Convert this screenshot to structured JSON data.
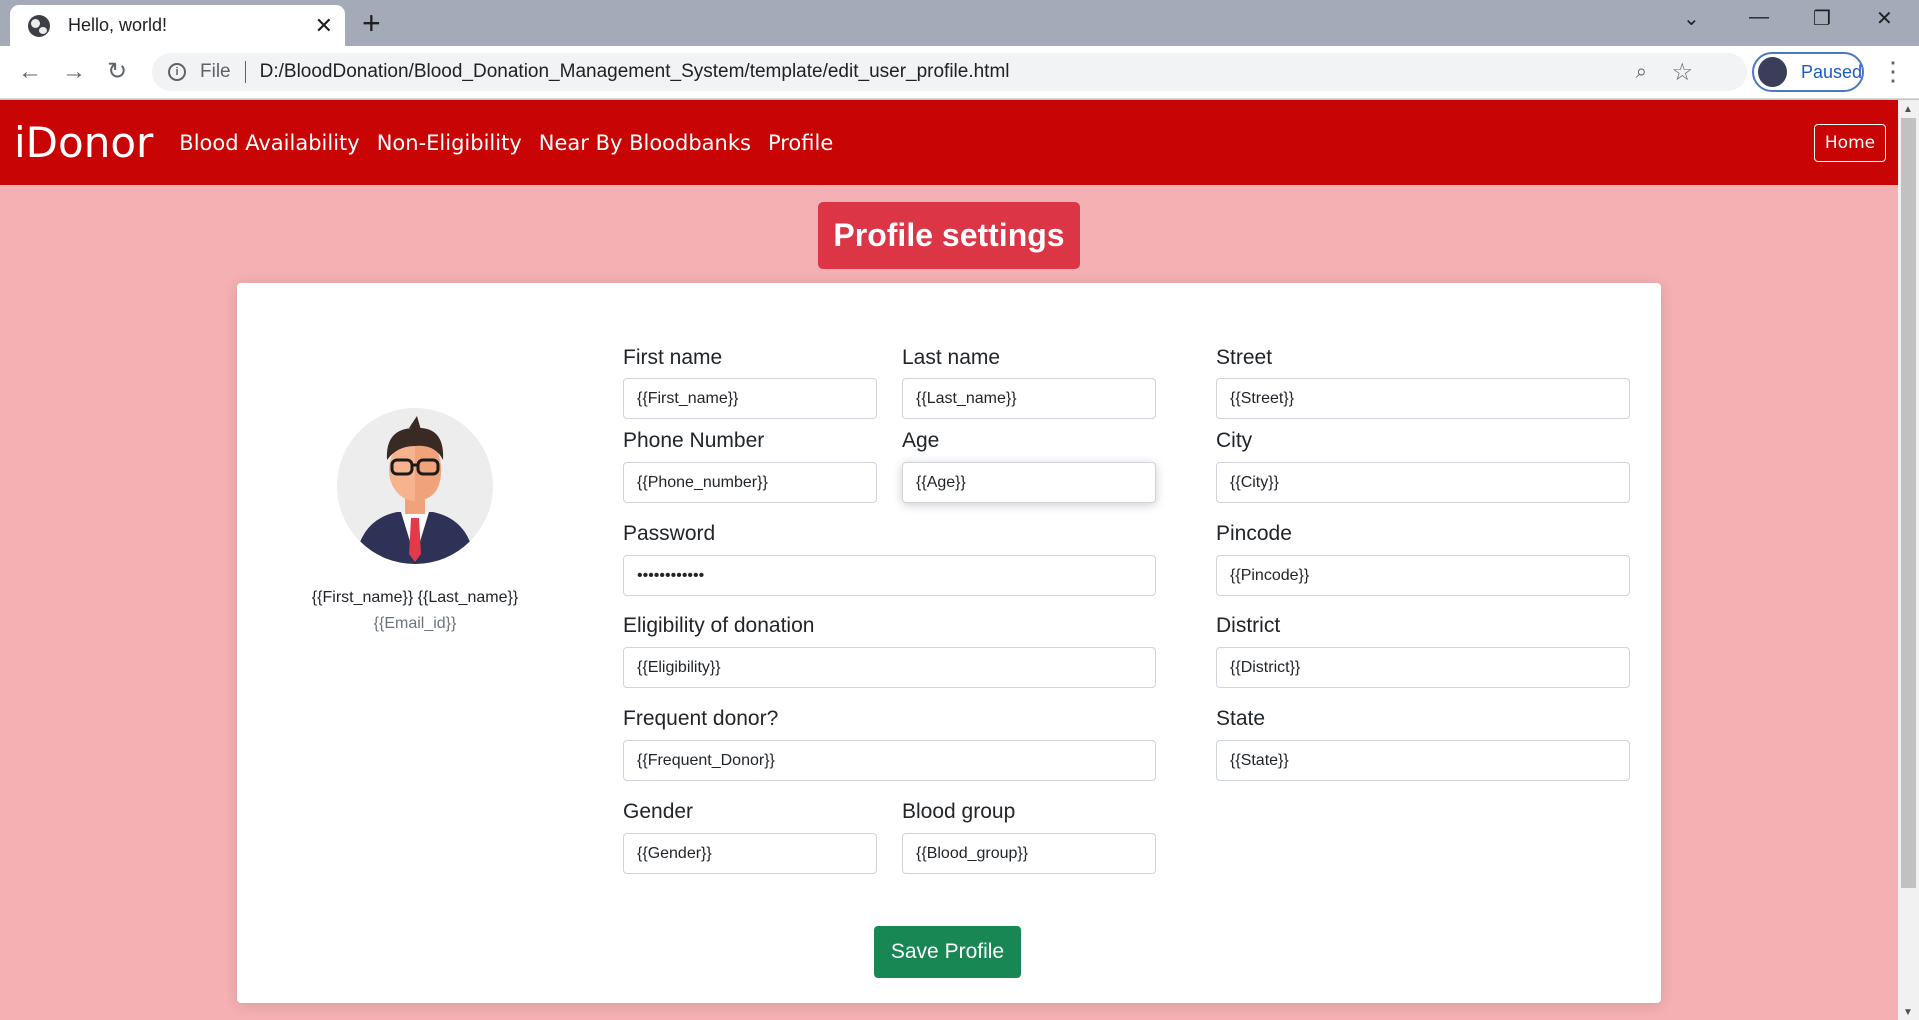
{
  "browser": {
    "tab_title": "Hello, world!",
    "address_scheme": "File",
    "url": "D:/BloodDonation/Blood_Donation_Management_System/template/edit_user_profile.html",
    "profile_status": "Paused"
  },
  "navbar": {
    "brand": "iDonor",
    "links": [
      "Blood Availability",
      "Non-Eligibility",
      "Near By Bloodbanks",
      "Profile"
    ],
    "home_label": "Home"
  },
  "page": {
    "heading": "Profile settings",
    "user_name": "{{First_name}} {{Last_name}}",
    "user_email": "{{Email_id}}",
    "save_label": "Save Profile"
  },
  "form": {
    "first_name": {
      "label": "First name",
      "value": "{{First_name}}"
    },
    "last_name": {
      "label": "Last name",
      "value": "{{Last_name}}"
    },
    "phone": {
      "label": "Phone Number",
      "value": "{{Phone_number}}"
    },
    "age": {
      "label": "Age",
      "value": "{{Age}}"
    },
    "password": {
      "label": "Password",
      "value": "••••••••••••"
    },
    "eligibility": {
      "label": "Eligibility of donation",
      "value": "{{Eligibility}}"
    },
    "frequent": {
      "label": "Frequent donor?",
      "value": "{{Frequent_Donor}}"
    },
    "gender": {
      "label": "Gender",
      "value": "{{Gender}}"
    },
    "blood_group": {
      "label": "Blood group",
      "value": "{{Blood_group}}"
    },
    "street": {
      "label": "Street",
      "value": "{{Street}}"
    },
    "city": {
      "label": "City",
      "value": "{{City}}"
    },
    "pincode": {
      "label": "Pincode",
      "value": "{{Pincode}}"
    },
    "district": {
      "label": "District",
      "value": "{{District}}"
    },
    "state": {
      "label": "State",
      "value": "{{State}}"
    }
  },
  "colors": {
    "navbar": "#c80405",
    "background": "#f4b0b2",
    "heading_bg": "#dc3545",
    "save_button": "#198754"
  }
}
